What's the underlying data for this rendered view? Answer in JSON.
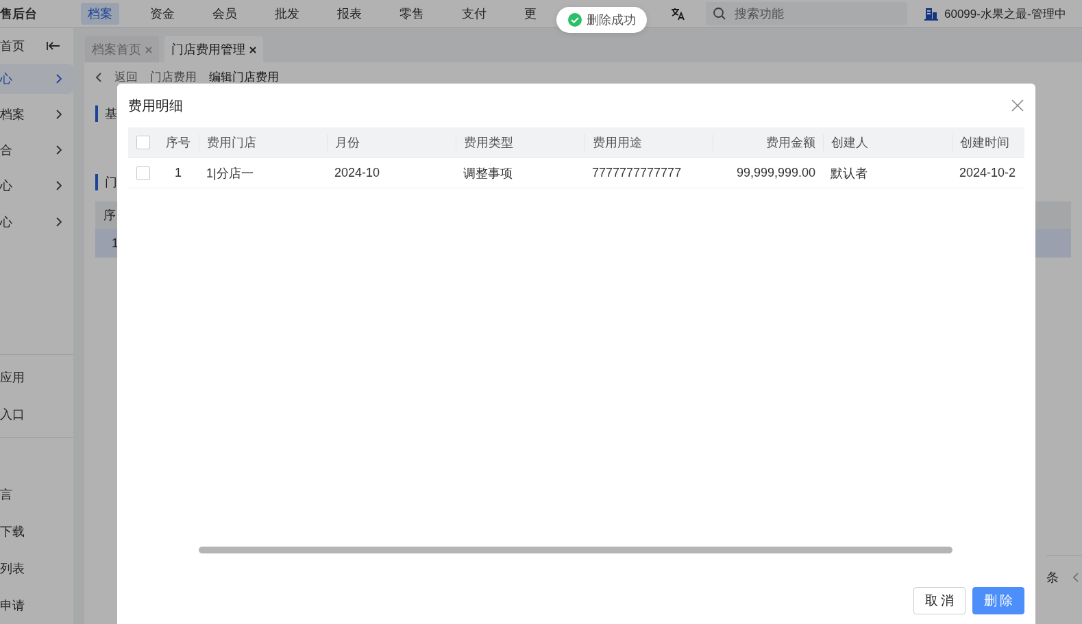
{
  "topbar": {
    "brand": "售后台",
    "nav": [
      {
        "label": "档案",
        "selected": true
      },
      {
        "label": "资金",
        "selected": false
      },
      {
        "label": "会员",
        "selected": false
      },
      {
        "label": "批发",
        "selected": false
      },
      {
        "label": "报表",
        "selected": false
      },
      {
        "label": "零售",
        "selected": false
      },
      {
        "label": "支付",
        "selected": false
      },
      {
        "label": "更",
        "selected": false
      }
    ],
    "search": {
      "placeholder": "搜索功能"
    },
    "account": "60099-水果之最-管理中"
  },
  "toast": {
    "text": "删除成功"
  },
  "sidebar": {
    "home": "首页",
    "items": [
      {
        "label": "心",
        "selected": true
      },
      {
        "label": "档案",
        "selected": false
      },
      {
        "label": "合",
        "selected": false
      },
      {
        "label": "心",
        "selected": false
      },
      {
        "label": "心",
        "selected": false
      }
    ],
    "apps": [
      "应用",
      "入口"
    ],
    "links": [
      "言",
      "下载",
      "列表",
      "申请"
    ]
  },
  "tabs": [
    {
      "label": "档案首页",
      "selected": false
    },
    {
      "label": "门店费用管理",
      "selected": true
    }
  ],
  "page": {
    "back": "返回",
    "breadcrumb": [
      "门店费用",
      "编辑门店费用"
    ],
    "sections": [
      "基",
      "门"
    ],
    "table_header": "序",
    "row_index": "1",
    "pagination": "条"
  },
  "dialog": {
    "title": "费用明细",
    "all_checked": false,
    "columns": [
      "序号",
      "费用门店",
      "月份",
      "费用类型",
      "费用用途",
      "费用金额",
      "创建人",
      "创建时间"
    ],
    "rows": [
      {
        "checked": false,
        "cells": [
          "1",
          "1|分店一",
          "2024-10",
          "调整事项",
          "7777777777777",
          "99,999,999.00",
          "默认者",
          "2024-10-2"
        ]
      }
    ],
    "buttons": [
      {
        "label": "取消",
        "kind": "secondary"
      },
      {
        "label": "删除",
        "kind": "primary"
      }
    ]
  }
}
